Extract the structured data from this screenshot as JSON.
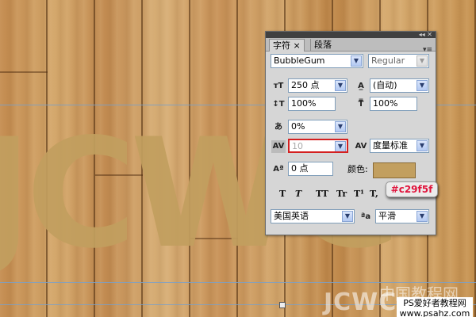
{
  "canvas": {
    "letters": "JCWC",
    "letter_color": "#c29f5f"
  },
  "watermark": {
    "cn_site": "中国教程网",
    "logo": "JCWC",
    "ps_line1": "PS爱好者教程网",
    "ps_line2": "www.psahz.com"
  },
  "panel": {
    "tabs": [
      {
        "label": "字符 ×"
      },
      {
        "label": "段落"
      }
    ],
    "font_family": {
      "value": "BubbleGum"
    },
    "font_style": {
      "value": "Regular"
    },
    "font_size": {
      "value": "250 点"
    },
    "leading": {
      "value": "(自动)"
    },
    "vertical_scale": {
      "value": "100%"
    },
    "horizontal_scale": {
      "value": "100%"
    },
    "tracking": {
      "value": "0%"
    },
    "kerning": {
      "value": "10"
    },
    "kerning_method": {
      "value": "度量标准"
    },
    "baseline_shift": {
      "value": "0 点"
    },
    "color_label": "颜色:",
    "color_value": "#c29f5f",
    "color_hex_badge": "#c29f5f",
    "format_buttons": [
      "T",
      "T",
      "TT",
      "Tr",
      "T¹",
      "T,"
    ],
    "language": {
      "value": "美国英语"
    },
    "antialias": {
      "value": "平滑"
    }
  }
}
